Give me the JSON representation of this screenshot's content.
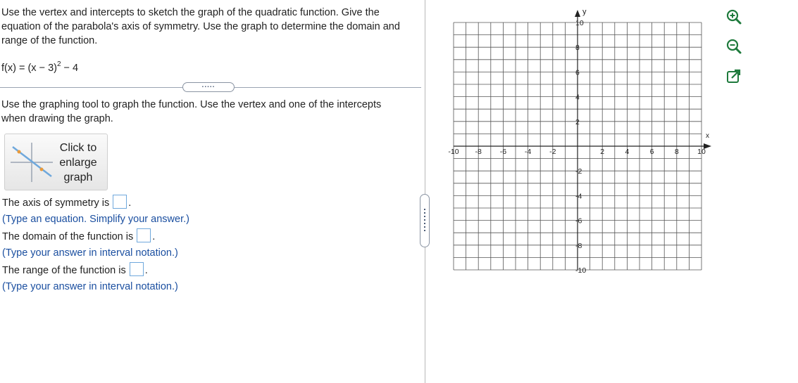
{
  "question": {
    "prompt": "Use the vertex and intercepts to sketch the graph of the quadratic function.  Give the equation of the parabola's axis of symmetry. Use the graph to determine the domain and range of the function.",
    "function_base": "f(x) = (x − 3)",
    "function_exponent": "2",
    "function_tail": " − 4",
    "expand_label": ".....",
    "instruction": "Use the graphing tool to graph the function.  Use the vertex and one of the intercepts when drawing the graph.",
    "enlarge_label": "Click to enlarge graph"
  },
  "answers": {
    "axis_label": "The axis of symmetry is",
    "axis_hint": "(Type an equation.  Simplify your answer.)",
    "domain_label": "The domain of the function is",
    "domain_hint": "(Type your answer in interval notation.)",
    "range_label": "The range of the function is",
    "range_hint": "(Type your answer in interval notation.)",
    "period": "."
  },
  "graph": {
    "x_axis_label": "x",
    "y_axis_label": "y",
    "x_ticks": [
      "-10",
      "-8",
      "-6",
      "-4",
      "-2",
      "2",
      "4",
      "6",
      "8",
      "10"
    ],
    "y_ticks": [
      "10",
      "8",
      "6",
      "4",
      "2",
      "-2",
      "-4",
      "-6",
      "-8",
      "-10"
    ],
    "x_range": [
      -10,
      10
    ],
    "y_range": [
      -10,
      10
    ],
    "grid": true
  },
  "tools": {
    "zoom_in": "zoom-in-icon",
    "zoom_out": "zoom-out-icon",
    "popout": "popout-icon",
    "accent": "#1e7a3c"
  }
}
